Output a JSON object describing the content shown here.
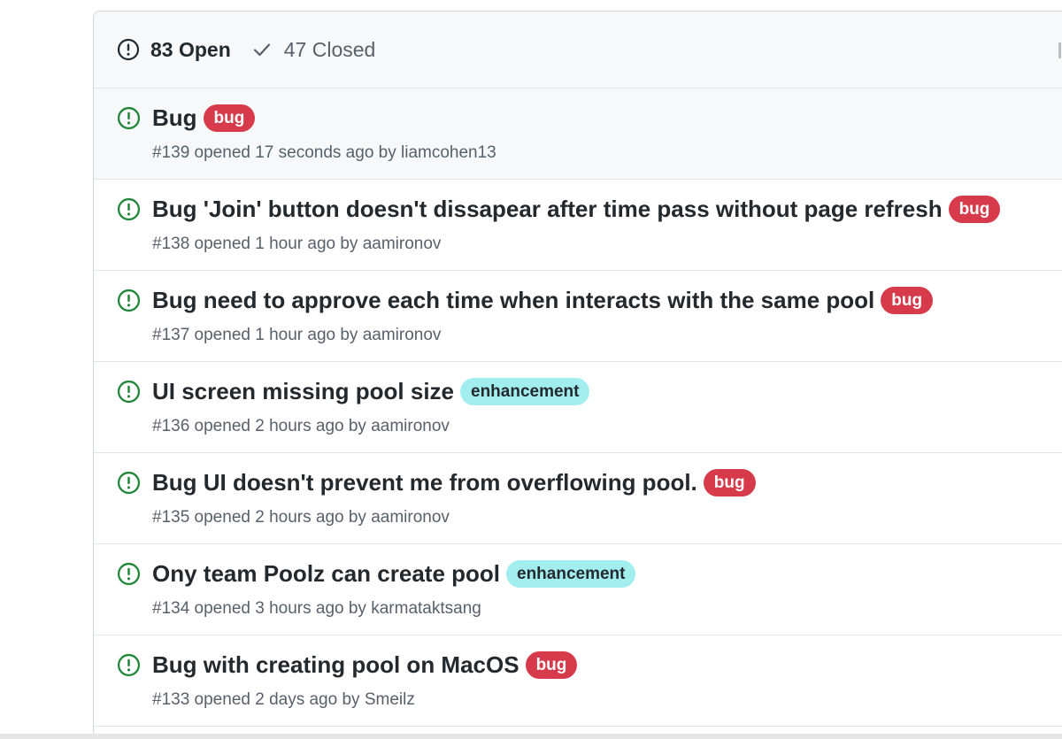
{
  "header": {
    "open_count_label": "83 Open",
    "closed_count_label": "47 Closed"
  },
  "issues": [
    {
      "title": "Bug",
      "label": "bug",
      "meta_prefix": "#139 opened 17 seconds ago by ",
      "author": "liamcohen13"
    },
    {
      "title": "Bug 'Join' button doesn't dissapear after time pass without page refresh",
      "label": "bug",
      "meta_prefix": "#138 opened 1 hour ago by ",
      "author": "aamironov"
    },
    {
      "title": "Bug need to approve each time when interacts with the same pool",
      "label": "bug",
      "meta_prefix": "#137 opened 1 hour ago by ",
      "author": "aamironov"
    },
    {
      "title": "UI screen missing pool size",
      "label": "enhancement",
      "meta_prefix": "#136 opened 2 hours ago by ",
      "author": "aamironov"
    },
    {
      "title": "Bug UI doesn't prevent me from overflowing pool.",
      "label": "bug",
      "meta_prefix": "#135 opened 2 hours ago by ",
      "author": "aamironov"
    },
    {
      "title": "Ony team Poolz can create pool",
      "label": "enhancement",
      "meta_prefix": "#134 opened 3 hours ago by ",
      "author": "karmataktsang"
    },
    {
      "title": "Bug with creating pool on MacOS",
      "label": "bug",
      "meta_prefix": "#133 opened 2 days ago by ",
      "author": "Smeilz"
    }
  ],
  "colors": {
    "open_green": "#22863a",
    "bug_red": "#d73a4a",
    "enhancement_cyan": "#a2eeef"
  },
  "icons": {
    "open": "issue-opened-icon",
    "closed": "check-icon"
  }
}
